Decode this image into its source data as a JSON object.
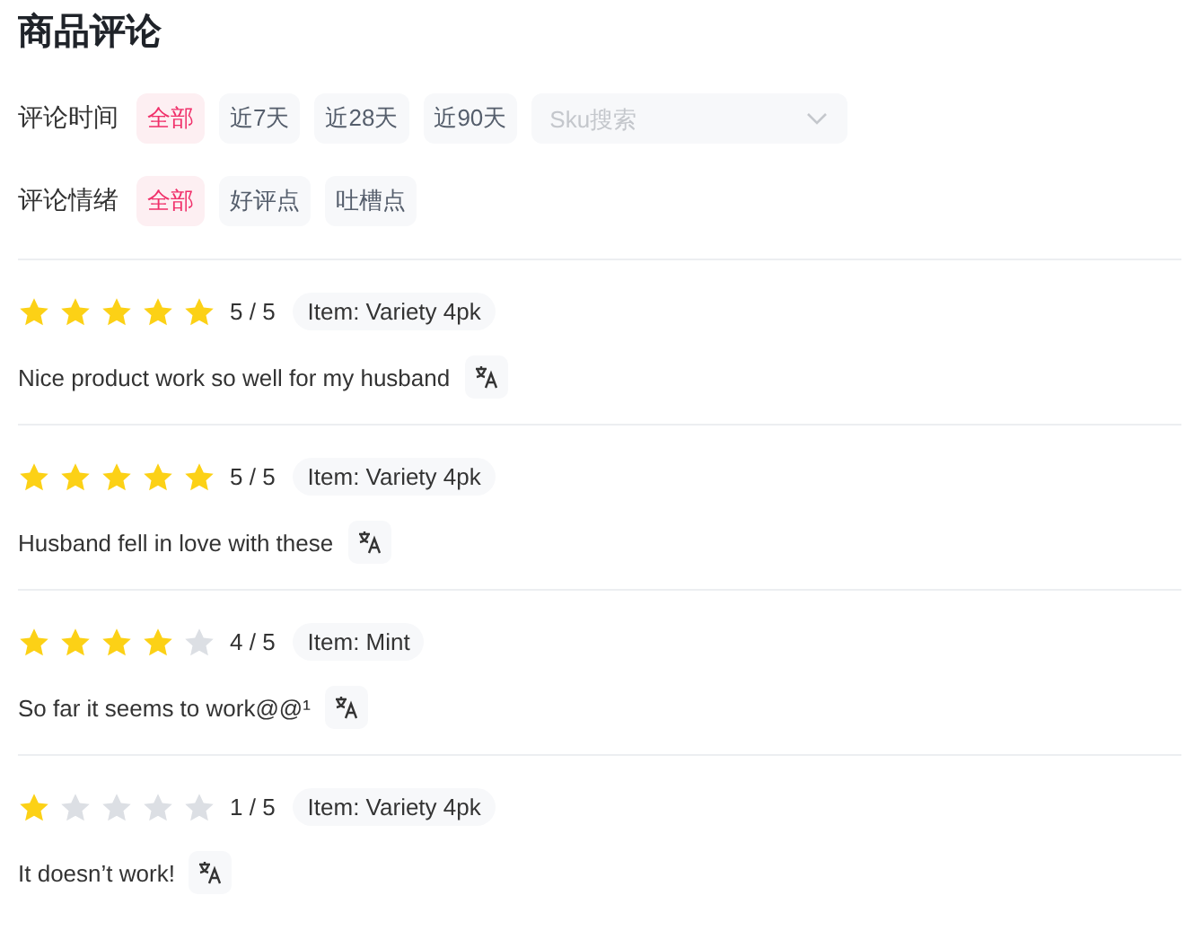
{
  "title": "商品评论",
  "filters": [
    {
      "label": "评论时间",
      "options": [
        {
          "label": "全部",
          "selected": true
        },
        {
          "label": "近7天",
          "selected": false
        },
        {
          "label": "近28天",
          "selected": false
        },
        {
          "label": "近90天",
          "selected": false
        }
      ],
      "search": {
        "placeholder": "Sku搜索"
      }
    },
    {
      "label": "评论情绪",
      "options": [
        {
          "label": "全部",
          "selected": true
        },
        {
          "label": "好评点",
          "selected": false
        },
        {
          "label": "吐槽点",
          "selected": false
        }
      ]
    }
  ],
  "reviews": [
    {
      "stars": 5,
      "score": "5 / 5",
      "item": "Item: Variety 4pk",
      "text": "Nice product work so well for my husband"
    },
    {
      "stars": 5,
      "score": "5 / 5",
      "item": "Item: Variety 4pk",
      "text": "Husband fell in love with these"
    },
    {
      "stars": 4,
      "score": "4 / 5",
      "item": "Item: Mint",
      "text": "So far it seems to work@@¹"
    },
    {
      "stars": 1,
      "score": "1 / 5",
      "item": "Item: Variety 4pk",
      "text": "It doesn’t work!"
    }
  ]
}
